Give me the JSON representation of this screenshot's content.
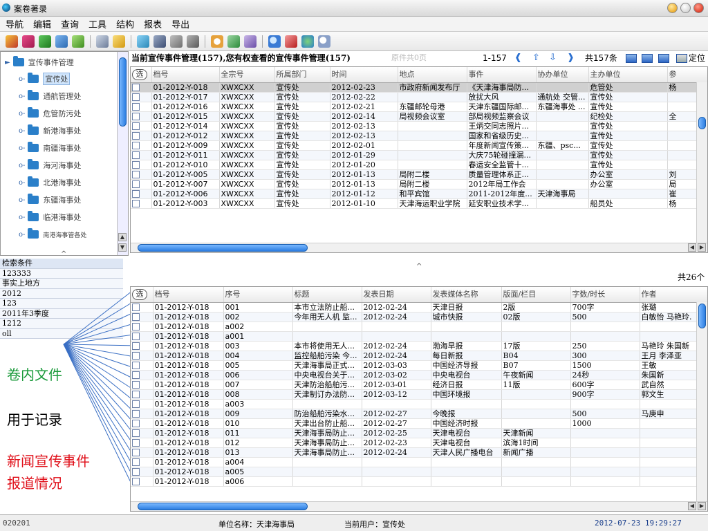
{
  "window": {
    "title": "案卷著录"
  },
  "menu": [
    "导航",
    "编辑",
    "查询",
    "工具",
    "结构",
    "报表",
    "导出"
  ],
  "toolbar_icons": [
    "pencil-icon",
    "eraser-icon",
    "add-icon",
    "arrow-icon",
    "check-icon",
    "cut-icon",
    "folder-icon",
    "refresh-icon",
    "book-icon",
    "doc-icon",
    "save-icon",
    "clock-icon",
    "chart-icon",
    "puzzle-icon",
    "search-icon",
    "link-icon",
    "globe-icon",
    "zoom-icon"
  ],
  "tree": {
    "root": "宣传事件管理",
    "items": [
      "宣传处",
      "通航管理处",
      "危管防污处",
      "新港海事处",
      "南疆海事处",
      "海河海事处",
      "北港海事处",
      "东疆海事处",
      "临港海事处",
      "南港海事管各处"
    ]
  },
  "conditions": {
    "label": "检索条件",
    "values": [
      "123333",
      "事实上地方",
      "2012",
      "123",
      "2011年3季度",
      "1212",
      "oll"
    ]
  },
  "annotations": {
    "a1": "卷内文件",
    "a2": "用于记录",
    "a3_line1": "新闻宣传事件",
    "a3_line2": "报道情况",
    "colors": {
      "green": "#1a9a3a",
      "black": "#000000",
      "red": "#e0101a"
    }
  },
  "upper": {
    "header": "当前宣传事件管理(157),您有权查看的宣传事件管理(157)",
    "gray_note": "原件共0页",
    "range": "1-157",
    "total": "共157条",
    "locate": "定位",
    "select_label": "选",
    "columns": [
      "档号",
      "全宗号",
      "所属部门",
      "时间",
      "地点",
      "事件",
      "协办单位",
      "主办单位",
      "参"
    ],
    "rows": [
      [
        "01-2012-Y-018",
        "XWXCXX",
        "宣传处",
        "2012-02-23",
        "市政府新闻发布厅",
        "《天津海事局防...",
        "",
        "危管处",
        "杨"
      ],
      [
        "01-2012-Y-017",
        "XWXCXX",
        "宣传处",
        "2012-02-22",
        "",
        "放扰大风",
        "通航处 交管...",
        "宣传处",
        ""
      ],
      [
        "01-2012-Y-016",
        "XWXCXX",
        "宣传处",
        "2012-02-21",
        "东疆邮轮母港",
        "天津东疆国际邮...",
        "东疆海事处 ...",
        "宣传处",
        ""
      ],
      [
        "01-2012-Y-015",
        "XWXCXX",
        "宣传处",
        "2012-02-14",
        "局视频会议室",
        "部局视频监察会议",
        "",
        "纪检处",
        "全"
      ],
      [
        "01-2012-Y-014",
        "XWXCXX",
        "宣传处",
        "2012-02-13",
        "",
        "王炳交同志照片...",
        "",
        "宣传处",
        ""
      ],
      [
        "01-2012-Y-012",
        "XWXCXX",
        "宣传处",
        "2012-02-13",
        "",
        "国家和省级历史...",
        "",
        "宣传处",
        ""
      ],
      [
        "01-2012-Y-009",
        "XWXCXX",
        "宣传处",
        "2012-02-01",
        "",
        "年度新闻宣传策...",
        "东疆、psc...",
        "宣传处",
        ""
      ],
      [
        "01-2012-Y-011",
        "XWXCXX",
        "宣传处",
        "2012-01-29",
        "",
        "大庆75轮碰撞漏...",
        "",
        "宣传处",
        ""
      ],
      [
        "01-2012-Y-010",
        "XWXCXX",
        "宣传处",
        "2012-01-20",
        "",
        "春运安全监管十...",
        "",
        "宣传处",
        ""
      ],
      [
        "01-2012-Y-005",
        "XWXCXX",
        "宣传处",
        "2012-01-13",
        "局附二楼",
        "质量管理体系正...",
        "",
        "办公室",
        "刘"
      ],
      [
        "01-2012-Y-007",
        "XWXCXX",
        "宣传处",
        "2012-01-13",
        "局附二楼",
        "2012年局工作会",
        "",
        "办公室",
        "局"
      ],
      [
        "01-2012-Y-006",
        "XWXCXX",
        "宣传处",
        "2012-01-12",
        "和平宾馆",
        "2011-2012年度...",
        "天津海事局",
        "",
        "崔"
      ],
      [
        "01-2012-Y-003",
        "XWXCXX",
        "宣传处",
        "2012-01-10",
        "天津海运职业学院",
        "延安职业技术学...",
        "",
        "船员处",
        "杨"
      ]
    ]
  },
  "lower": {
    "total": "共26个",
    "select_label": "选",
    "columns": [
      "档号",
      "序号",
      "标题",
      "发表日期",
      "发表媒体名称",
      "版面/栏目",
      "字数/时长",
      "作者"
    ],
    "rows": [
      [
        "01-2012-Y-018",
        "001",
        "本市立法防止船...",
        "2012-02-24",
        "天津日报",
        "2版",
        "700字",
        "张璐"
      ],
      [
        "01-2012-Y-018",
        "002",
        "今年用无人机 监...",
        "2012-02-24",
        "城市快报",
        "02版",
        "500",
        "白敏怡 马艳玲."
      ],
      [
        "01-2012-Y-018",
        "a002",
        "",
        "",
        "",
        "",
        "",
        ""
      ],
      [
        "01-2012-Y-018",
        "a001",
        "",
        "",
        "",
        "",
        "",
        ""
      ],
      [
        "01-2012-Y-018",
        "003",
        "本市将使用无人...",
        "2012-02-24",
        "渤海早报",
        "17版",
        "250",
        "马艳玲 朱国新"
      ],
      [
        "01-2012-Y-018",
        "004",
        "监控船舶污染 今...",
        "2012-02-24",
        "每日新报",
        "B04",
        "300",
        "王月 李泽亚"
      ],
      [
        "01-2012-Y-018",
        "005",
        "天津海事局正式...",
        "2012-03-03",
        "中国经济导报",
        "B07",
        "1500",
        "王敏"
      ],
      [
        "01-2012-Y-018",
        "006",
        "中央电视台关于...",
        "2012-03-02",
        "中央电视台",
        "午夜新闻",
        "24秒",
        "朱国新"
      ],
      [
        "01-2012-Y-018",
        "007",
        "天津防治船舶污...",
        "2012-03-01",
        "经济日报",
        "11版",
        "600字",
        "武自然"
      ],
      [
        "01-2012-Y-018",
        "008",
        "天津制订办法防...",
        "2012-03-12",
        "中国环境报",
        "",
        "900字",
        "郭文生"
      ],
      [
        "01-2012-Y-018",
        "a003",
        "",
        "",
        "",
        "",
        "",
        ""
      ],
      [
        "01-2012-Y-018",
        "009",
        "防治船舶污染水...",
        "2012-02-27",
        "今晚报",
        "",
        "500",
        "马庚申"
      ],
      [
        "01-2012-Y-018",
        "010",
        "天津出台防止船...",
        "2012-02-27",
        "中国经济时报",
        "",
        "1000",
        ""
      ],
      [
        "01-2012-Y-018",
        "011",
        "天津海事局防止...",
        "2012-02-25",
        "天津电视台",
        "天津新闻",
        "",
        ""
      ],
      [
        "01-2012-Y-018",
        "012",
        "天津海事局防止...",
        "2012-02-23",
        "天津电视台",
        "滨海1时间",
        "",
        ""
      ],
      [
        "01-2012-Y-018",
        "013",
        "天津海事局防止...",
        "2012-02-24",
        "天津人民广播电台",
        "新闻广播",
        "",
        ""
      ],
      [
        "01-2012-Y-018",
        "a004",
        "",
        "",
        "",
        "",
        "",
        ""
      ],
      [
        "01-2012-Y-018",
        "a005",
        "",
        "",
        "",
        "",
        "",
        ""
      ],
      [
        "01-2012-Y-018",
        "a006",
        "",
        "",
        "",
        "",
        "",
        ""
      ]
    ]
  },
  "status": {
    "left": "020201",
    "unit": "单位名称：天津海事局",
    "user": "当前用户：宣传处",
    "datetime": "2012-07-23 19:29:27"
  }
}
